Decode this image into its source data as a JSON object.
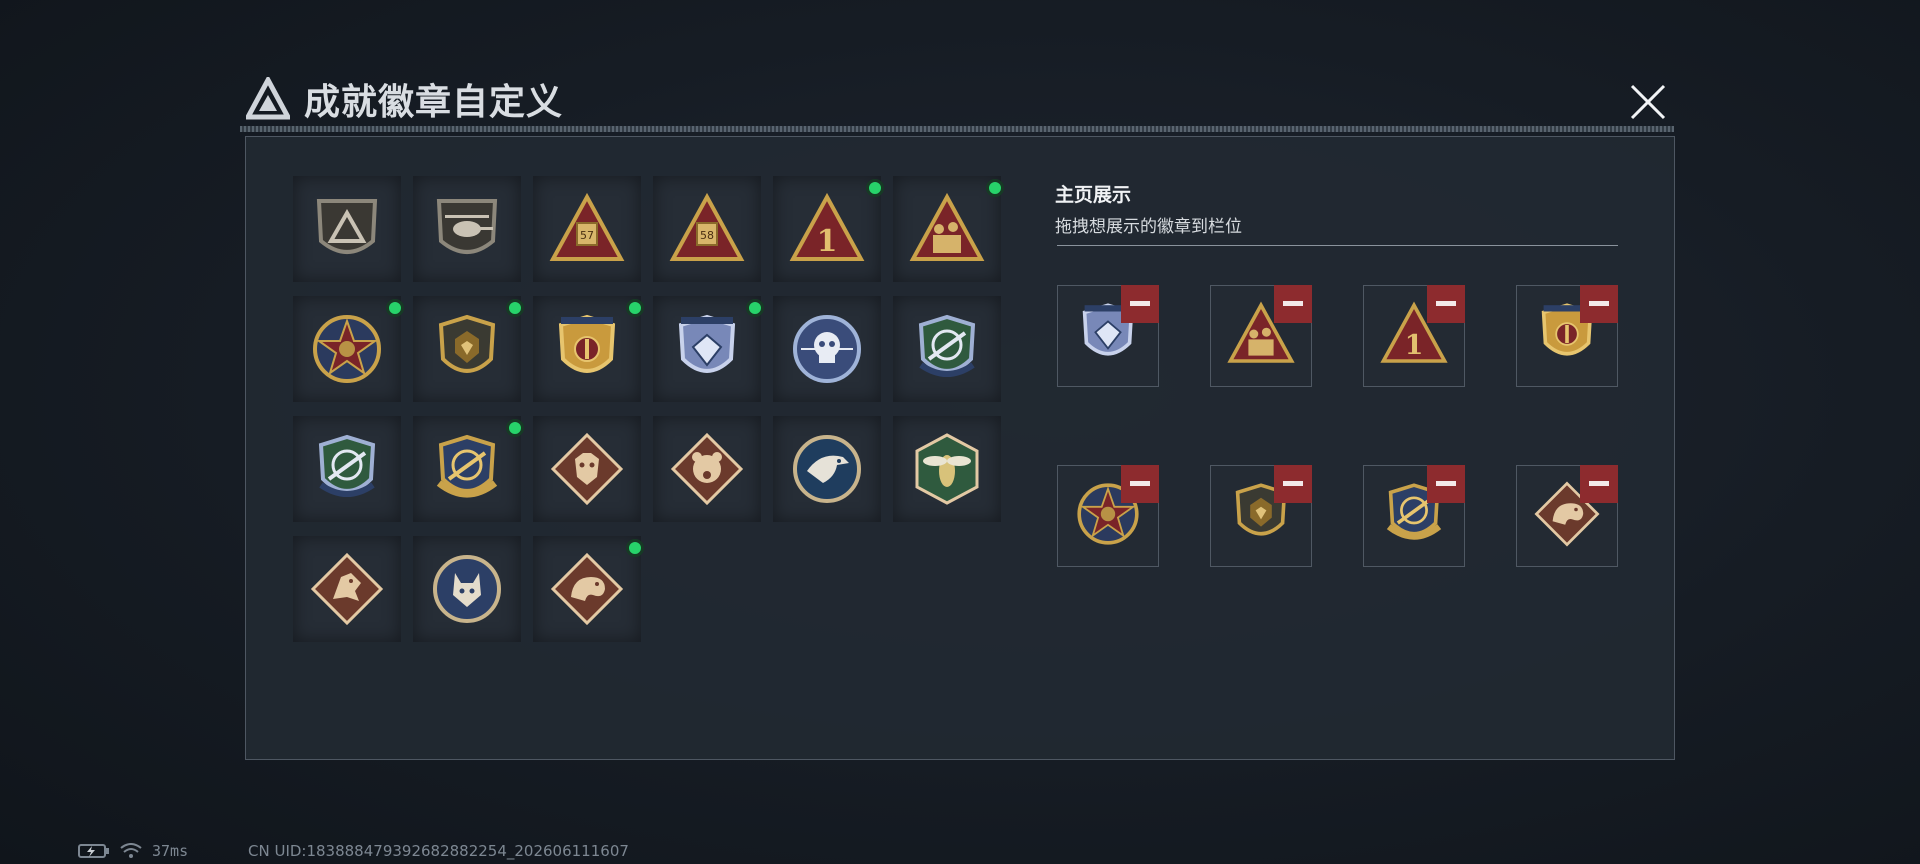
{
  "window": {
    "title": "成就徽章自定义"
  },
  "colors": {
    "accent_green": "#27d36a",
    "remove_red": "#8d2b2e",
    "panel_bg": "#222932"
  },
  "badges": [
    {
      "icon": "triangle-logo-shield-badge-icon",
      "new": false
    },
    {
      "icon": "helicopter-shield-badge-icon",
      "new": false
    },
    {
      "icon": "triangle-57-badge-icon",
      "new": false
    },
    {
      "icon": "triangle-58-badge-icon",
      "new": false
    },
    {
      "icon": "triangle-rank-1-badge-icon",
      "new": true
    },
    {
      "icon": "triangle-soldiers-badge-icon",
      "new": true
    },
    {
      "icon": "star-medal-badge-icon",
      "new": true
    },
    {
      "icon": "dark-shield-emblem-badge-icon",
      "new": true
    },
    {
      "icon": "gold-laurel-shield-badge-icon",
      "new": true
    },
    {
      "icon": "blue-diamond-shield-badge-icon",
      "new": true
    },
    {
      "icon": "skull-round-badge-icon",
      "new": false
    },
    {
      "icon": "crosshair-rifle-blue-badge-icon",
      "new": false
    },
    {
      "icon": "crosshair-rifle-green-badge-icon",
      "new": false
    },
    {
      "icon": "gold-crosshair-shield-badge-icon",
      "new": true
    },
    {
      "icon": "wolf-diamond-badge-icon",
      "new": false
    },
    {
      "icon": "bear-diamond-badge-icon",
      "new": false
    },
    {
      "icon": "eagle-round-badge-icon",
      "new": false
    },
    {
      "icon": "hornet-hexagon-badge-icon",
      "new": false
    },
    {
      "icon": "dragon-diamond-badge-icon",
      "new": false
    },
    {
      "icon": "lynx-round-badge-icon",
      "new": false
    },
    {
      "icon": "serpent-diamond-badge-icon",
      "new": true
    }
  ],
  "display": {
    "title": "主页展示",
    "subtitle": "拖拽想展示的徽章到栏位",
    "slots": [
      {
        "icon": "blue-diamond-shield-badge-icon"
      },
      {
        "icon": "triangle-soldiers-badge-icon"
      },
      {
        "icon": "triangle-rank-1-badge-icon"
      },
      {
        "icon": "gold-laurel-shield-badge-icon"
      },
      {
        "icon": "star-medal-badge-icon"
      },
      {
        "icon": "dark-shield-emblem-badge-icon"
      },
      {
        "icon": "gold-crosshair-shield-badge-icon"
      },
      {
        "icon": "serpent-diamond-badge-icon"
      }
    ]
  },
  "status": {
    "ping": "37ms",
    "uid": "CN UID:18388847939268288​2254_202606111607"
  }
}
